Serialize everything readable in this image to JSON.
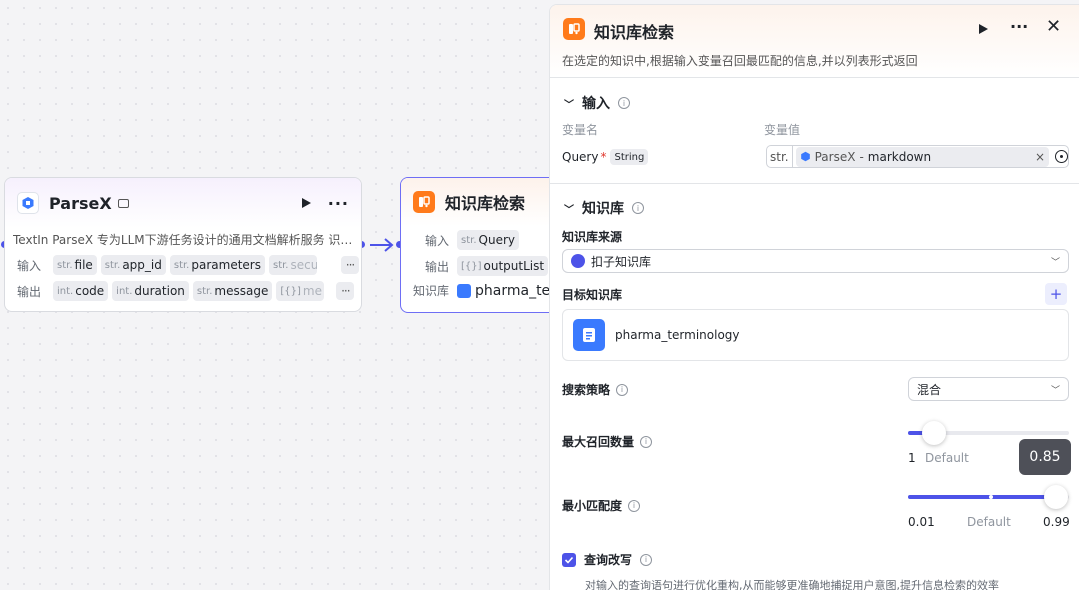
{
  "node_parsex": {
    "title": "ParseX",
    "description": "TextIn ParseX 专为LLM下游任务设计的通用文档解析服务 识…",
    "input_label": "输入",
    "output_label": "输出",
    "inputs": [
      {
        "type": "str.",
        "name": "file"
      },
      {
        "type": "str.",
        "name": "app_id"
      },
      {
        "type": "str.",
        "name": "parameters"
      },
      {
        "type": "str.",
        "name": "secu"
      }
    ],
    "outputs": [
      {
        "type": "int.",
        "name": "code"
      },
      {
        "type": "int.",
        "name": "duration"
      },
      {
        "type": "str.",
        "name": "message"
      },
      {
        "type": "[{}]",
        "name": "me"
      }
    ],
    "more": "···"
  },
  "node_kb": {
    "title": "知识库检索",
    "input_label": "输入",
    "output_label": "输出",
    "kb_label": "知识库",
    "input": {
      "type": "str.",
      "name": "Query"
    },
    "output": {
      "type": "[{}]",
      "name": "outputList"
    },
    "kb_value": "pharma_te"
  },
  "panel": {
    "title": "知识库检索",
    "subtitle": "在选定的知识中,根据输入变量召回最匹配的信息,并以列表形式返回",
    "input_section": {
      "title": "输入",
      "col_name": "变量名",
      "col_value": "变量值",
      "var_name": "Query",
      "required_mark": "*",
      "var_type": "String",
      "value_prefix": "str.",
      "value_source": "ParseX",
      "value_sep": "-",
      "value_field": "markdown",
      "clear": "×"
    },
    "kb_section": {
      "title": "知识库",
      "source_label": "知识库来源",
      "source_value": "扣子知识库",
      "target_label": "目标知识库",
      "add": "+",
      "kb_name": "pharma_terminology"
    },
    "strategy": {
      "label": "搜索策略",
      "value": "混合"
    },
    "max_recall": {
      "label": "最大召回数量",
      "min": "1",
      "default_label": "Default",
      "value_fraction": 0.1
    },
    "min_match": {
      "label": "最小匹配度",
      "min": "0.01",
      "default_label": "Default",
      "max": "0.99",
      "tooltip": "0.85",
      "value": 0.85,
      "default_fraction": 0.5
    },
    "rewrite": {
      "label": "查询改写",
      "checked": true,
      "description": "对输入的查询语句进行优化重构,从而能够更准确地捕捉用户意图,提升信息检索的效率"
    }
  },
  "colors": {
    "accent": "#4d53e8",
    "orange": "#ff7a1a",
    "blue": "#3a7afe"
  }
}
